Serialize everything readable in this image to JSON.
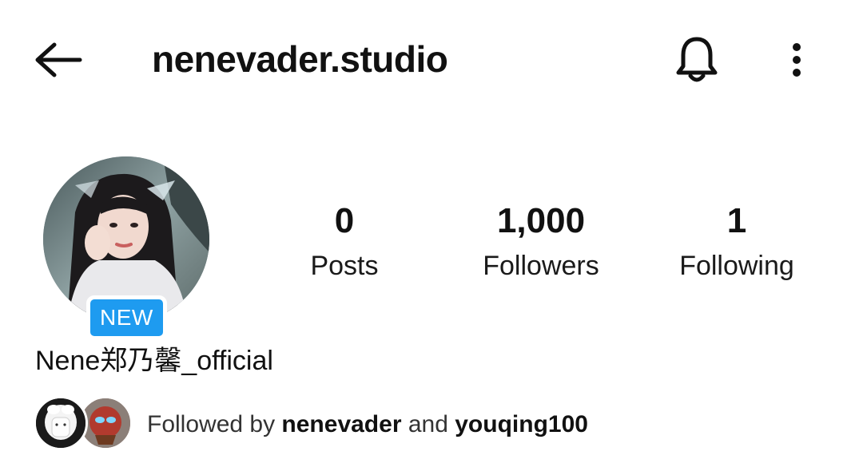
{
  "header": {
    "back_icon": "arrow-left-icon",
    "username": "nenevader.studio",
    "bell_icon": "bell-icon",
    "more_icon": "more-vertical-icon"
  },
  "profile": {
    "badge": "NEW",
    "display_name": "Nene郑乃馨_official",
    "stats": [
      {
        "count": "0",
        "label": "Posts"
      },
      {
        "count": "1,000",
        "label": "Followers"
      },
      {
        "count": "1",
        "label": "Following"
      }
    ]
  },
  "followed_by": {
    "prefix": "Followed by",
    "user1": "nenevader",
    "connector": "and",
    "user2": "youqing100"
  },
  "colors": {
    "badge": "#1e9bf0",
    "text": "#111111"
  }
}
